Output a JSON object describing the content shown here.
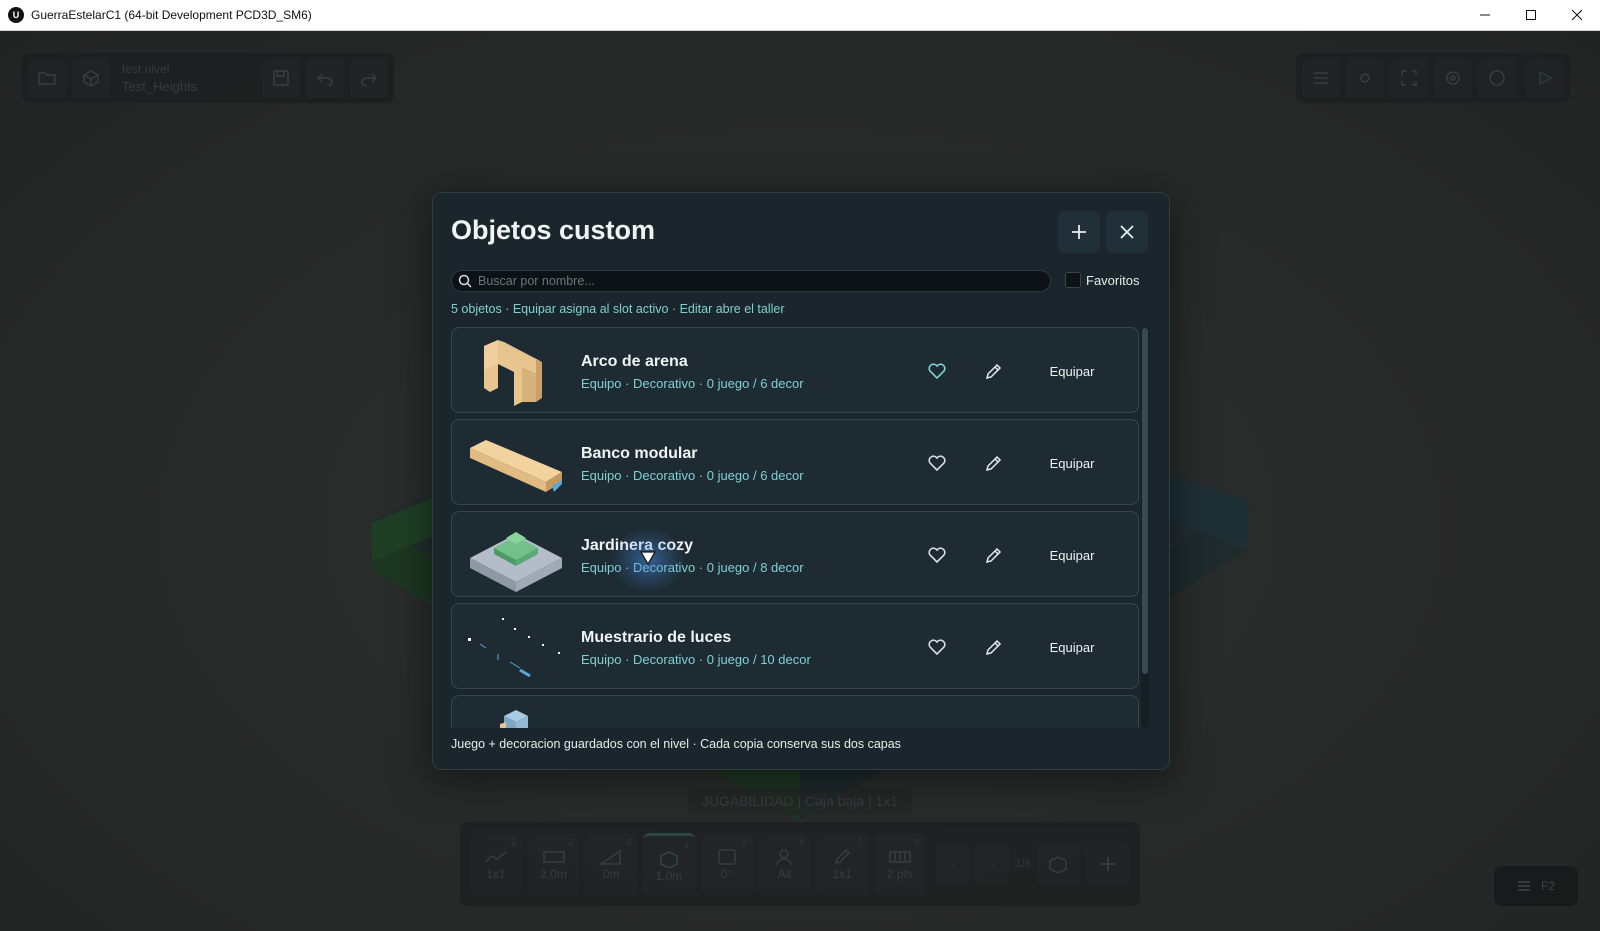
{
  "window": {
    "title": "GuerraEstelarC1 (64-bit Development PCD3D_SM6)",
    "logo_letter": "U"
  },
  "editor": {
    "project_line1": "test nivel",
    "project_line2": "Test_Heights",
    "status_text": "JUGABILIDAD | Caja baja | 1x1",
    "f2_label": "F2",
    "bottom_tools": [
      {
        "num": "1",
        "label": "1x1",
        "icon": "terrain-icon"
      },
      {
        "num": "2",
        "label": "2.0m",
        "icon": "wall-icon"
      },
      {
        "num": "3",
        "label": "0m",
        "icon": "ramp-icon"
      },
      {
        "num": "4",
        "label": "1.0m",
        "icon": "box-icon"
      },
      {
        "num": "5",
        "label": "0°",
        "icon": "rotate-icon"
      },
      {
        "num": "6",
        "label": "All",
        "icon": "user-icon"
      },
      {
        "num": "7",
        "label": "1x1",
        "icon": "pencil-icon"
      },
      {
        "num": "8",
        "label": "2 pts",
        "icon": "grid-icon"
      }
    ],
    "small_btn_label": "-",
    "page_indicator": "1/8"
  },
  "modal": {
    "title": "Objetos custom",
    "search_placeholder": "Buscar por nombre...",
    "favorites_label": "Favoritos",
    "info_line": "5 objetos · Equipar asigna al slot activo · Editar abre el taller",
    "footer": "Juego + decoracion guardados con el nivel · Cada copia conserva sus dos capas",
    "equip_label": "Equipar",
    "items": [
      {
        "name": "Arco de arena",
        "meta": "Equipo · Decorativo · 0 juego / 6 decor",
        "favorite": true
      },
      {
        "name": "Banco modular",
        "meta": "Equipo · Decorativo · 0 juego / 6 decor",
        "favorite": false
      },
      {
        "name": "Jardinera cozy",
        "meta": "Equipo · Decorativo · 0 juego / 8 decor",
        "favorite": false
      },
      {
        "name": "Muestrario de luces",
        "meta": "Equipo · Decorativo · 0 juego / 10 decor",
        "favorite": false
      },
      {
        "name": "",
        "meta": "",
        "favorite": false
      }
    ]
  },
  "colors": {
    "accent_teal": "#7fd0d6",
    "modal_bg": "#1b262c",
    "row_bg": "#1e2b32",
    "sand": "#e8c48e"
  }
}
